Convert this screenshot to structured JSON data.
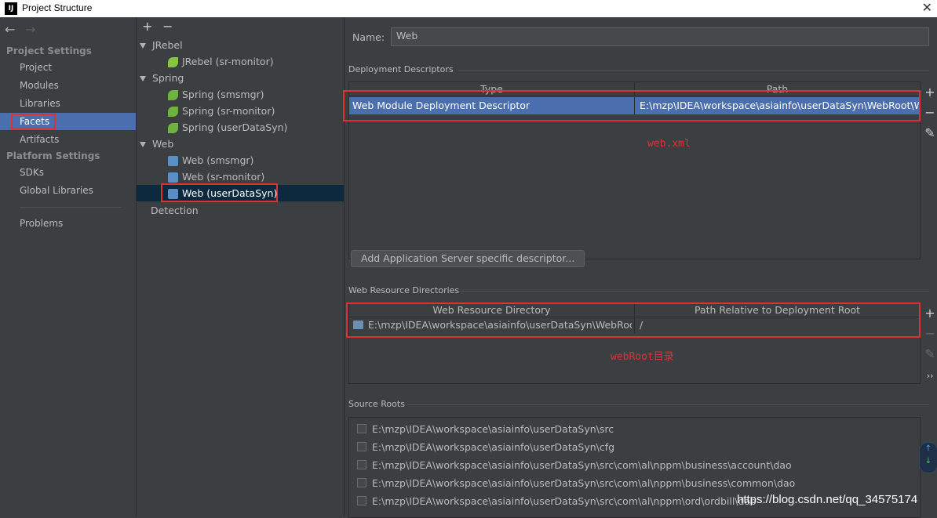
{
  "window": {
    "title": "Project Structure",
    "app_icon": "IJ"
  },
  "nav": {
    "back": "←",
    "forward": "→",
    "project_settings_label": "Project Settings",
    "project_items": [
      "Project",
      "Modules",
      "Libraries",
      "Facets",
      "Artifacts"
    ],
    "platform_settings_label": "Platform Settings",
    "platform_items": [
      "SDKs",
      "Global Libraries"
    ],
    "problems": "Problems",
    "selected": "Facets"
  },
  "tree": {
    "add": "+",
    "remove": "−",
    "groups": [
      {
        "label": "JRebel",
        "children": [
          "JRebel (sr-monitor)"
        ]
      },
      {
        "label": "Spring",
        "children": [
          "Spring (smsmgr)",
          "Spring (sr-monitor)",
          "Spring (userDataSyn)"
        ]
      },
      {
        "label": "Web",
        "children": [
          "Web (smsmgr)",
          "Web (sr-monitor)",
          "Web (userDataSyn)"
        ]
      }
    ],
    "detection": "Detection",
    "selected": "Web (userDataSyn)"
  },
  "detail": {
    "name_label": "Name:",
    "name_value": "Web",
    "deployment_title": "Deployment Descriptors",
    "dd_headers": [
      "Type",
      "Path"
    ],
    "dd_row": [
      "Web Module Deployment Descriptor",
      "E:\\mzp\\IDEA\\workspace\\asiainfo\\userDataSyn\\WebRoot\\WEB"
    ],
    "annotation1": "web.xml",
    "add_server_button": "Add Application Server specific descriptor...",
    "resources_title": "Web Resource Directories",
    "wr_headers": [
      "Web Resource Directory",
      "Path Relative to Deployment Root"
    ],
    "wr_row": [
      "E:\\mzp\\IDEA\\workspace\\asiainfo\\userDataSyn\\WebRoot",
      "/"
    ],
    "annotation2": "webRoot目录",
    "source_title": "Source Roots",
    "source_roots": [
      "E:\\mzp\\IDEA\\workspace\\asiainfo\\userDataSyn\\src",
      "E:\\mzp\\IDEA\\workspace\\asiainfo\\userDataSyn\\cfg",
      "E:\\mzp\\IDEA\\workspace\\asiainfo\\userDataSyn\\src\\com\\al\\nppm\\business\\account\\dao",
      "E:\\mzp\\IDEA\\workspace\\asiainfo\\userDataSyn\\src\\com\\al\\nppm\\business\\common\\dao",
      "E:\\mzp\\IDEA\\workspace\\asiainfo\\userDataSyn\\src\\com\\al\\nppm\\ord\\ordbill\\dao"
    ],
    "side_add": "+",
    "side_remove": "−",
    "side_more": "››"
  },
  "watermark": "https://blog.csdn.net/qq_34575174",
  "colors": {
    "selection": "#4b6eaf",
    "annotation": "#e03131",
    "background": "#3c3f41"
  }
}
